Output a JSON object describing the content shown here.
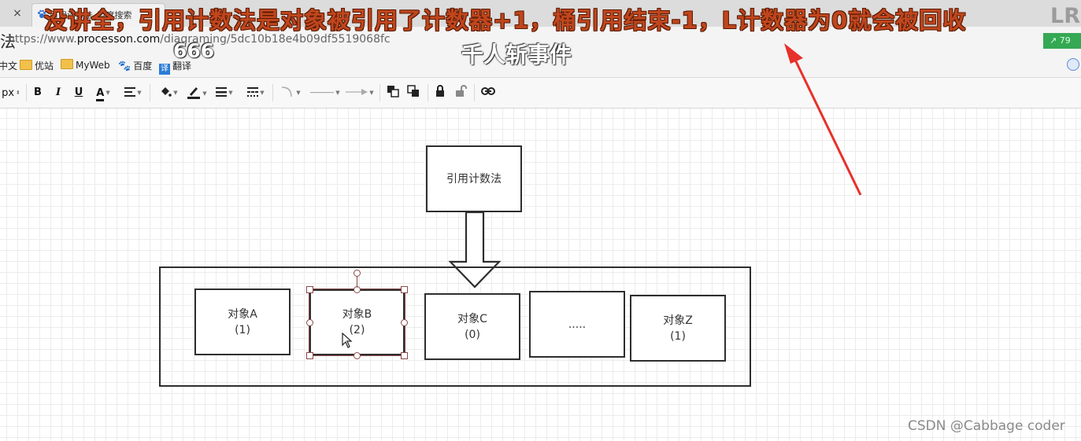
{
  "browser": {
    "tab_close": "×",
    "tab_title": "引用计数法_百度搜索",
    "page_glyph": "法",
    "url_prefix": "https://www.",
    "url_domain": "processon.com",
    "url_path": "/diagraming/5dc10b18e4b09df5519068fc",
    "zoom_badge": "↗ 79"
  },
  "bookmarks": [
    {
      "label": "中文",
      "icon": "text-icon"
    },
    {
      "label": "优站",
      "icon": "folder-icon"
    },
    {
      "label": "MyWeb",
      "icon": "folder-icon"
    },
    {
      "label": "百度",
      "icon": "baidu-paw-icon"
    },
    {
      "label": "翻译",
      "icon": "translate-icon"
    }
  ],
  "toolbar": {
    "font_size_unit": "px",
    "bold": "B",
    "italic": "I",
    "underline": "U",
    "font_color": "A"
  },
  "diagram": {
    "root": "引用计数法",
    "objects": [
      {
        "name": "对象A",
        "count": "(1)"
      },
      {
        "name": "对象B",
        "count": "(2)"
      },
      {
        "name": "对象C",
        "count": "(0)"
      },
      {
        "name": ".....",
        "count": ""
      },
      {
        "name": "对象Z",
        "count": "(1)"
      }
    ]
  },
  "overlay": {
    "caption": "没讲全，引用计数法是对象被引用了计数器+1，桶引用结束-1，L计数器为0就会被回收",
    "caption_tail": "LRU",
    "sub_caption": "千人斩事件",
    "danmaku": "666",
    "watermark": "CSDN @Cabbage coder"
  },
  "colors": {
    "caption": "#c0461e",
    "arrow": "#e8302a",
    "zoom_badge": "#35a853",
    "selection": "#8a4a4a"
  }
}
